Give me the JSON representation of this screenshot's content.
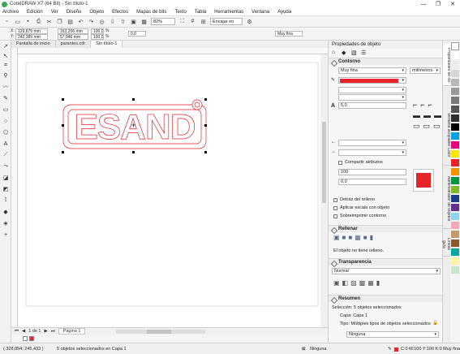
{
  "window": {
    "title": "CorelDRAW X7 (64 Bit) - Sin título-1",
    "minimize": "—",
    "maximize": "❐",
    "close": "✕"
  },
  "menu": [
    "Archivo",
    "Edición",
    "Ver",
    "Diseño",
    "Objeto",
    "Efectos",
    "Mapas de bits",
    "Texto",
    "Tabla",
    "Herramientas",
    "Ventana",
    "Ayuda"
  ],
  "standard_toolbar": {
    "zoom": "82%",
    "snap": "Encajar en"
  },
  "property_bar": {
    "x": "129,875 mm",
    "y": "242,389 mm",
    "width": "163,206 mm",
    "height": "57,946 mm",
    "scale_w": "100,0",
    "scale_h": "100,0",
    "pct": "%",
    "angle": "0,0",
    "line_width": "Muy fina",
    "x_label": "X:",
    "y_label": "Y:"
  },
  "doc_tabs": [
    "Pantalla de inicio",
    "parantes.cdr",
    "Sin título-1"
  ],
  "canvas_text": "ESAND",
  "bottom_bar": {
    "page_info": "1 de 1",
    "page_tab": "Página 1"
  },
  "status": {
    "coords": "( 328,054; 245,433 )",
    "message": "5 objetos seleccionados en Capa 1",
    "fill": "Ninguna",
    "outline": "C:0 M:100 Y:100 K:0  Muy fina"
  },
  "docker": {
    "title": "Propiedades de objeto",
    "contour": {
      "header": "Contorno",
      "width": "Muy fina",
      "units": "milímetros",
      "miter": "5,0",
      "color": "#e8232a",
      "shared": "Compartir atributos",
      "scale_a": "100",
      "scale_b": "0,0",
      "behind": "Detrás del relleno",
      "scale_obj": "Aplicar escala con objeto",
      "overprint": "Sobreimprimir contorno"
    },
    "fill": {
      "header": "Rellenar",
      "note": "El objeto no tiene relleno."
    },
    "transparency": {
      "header": "Transparencia",
      "mode": "Normal"
    },
    "summary": {
      "header": "Resumen",
      "selection": "Selección: 5 objetos seleccionados",
      "layer": "Capa: Capa 1",
      "type": "Tipo: Múltiples tipos de objetos seleccionados",
      "none": "Ninguna"
    }
  },
  "side_tabs": [
    "Propiedades de ob",
    "Ventana acoplable Color",
    "Administrador de objetos",
    "Líneas guía"
  ],
  "accent_red": "#e8232a"
}
